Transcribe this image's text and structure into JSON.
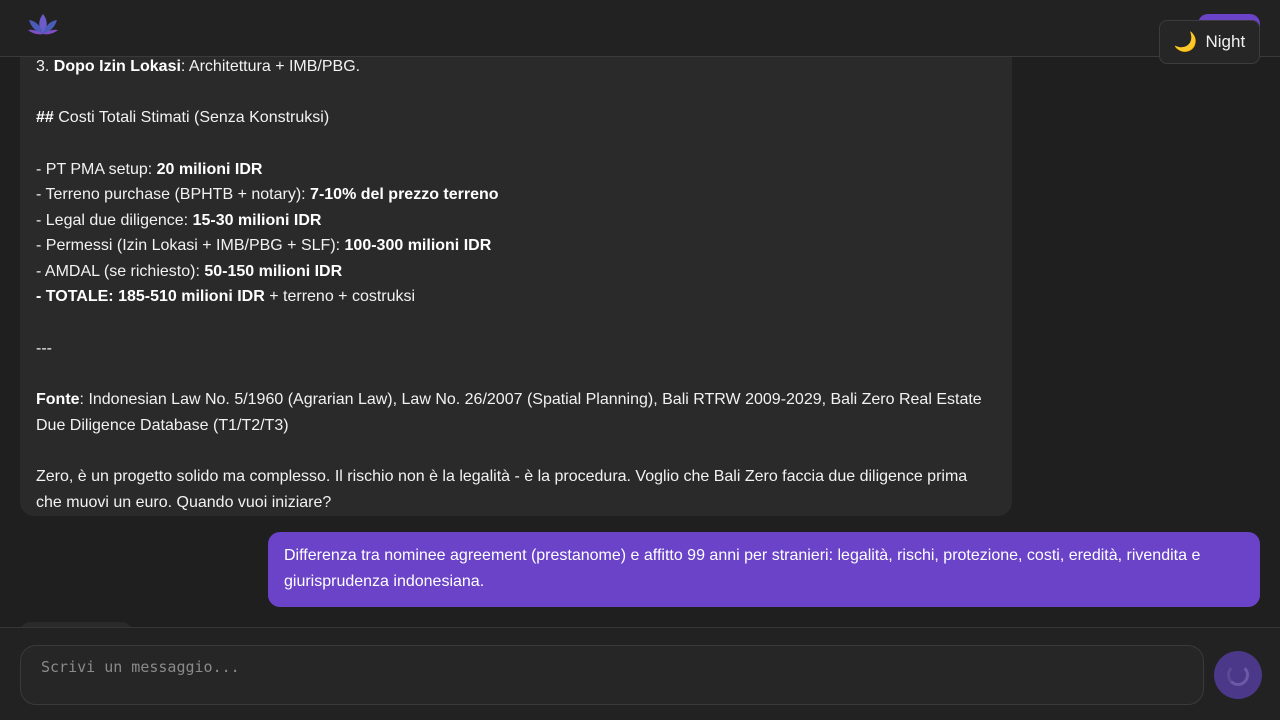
{
  "header": {
    "night_label": "Night",
    "night_icon": "moon-icon",
    "accent_color": "#6a43c9"
  },
  "chat": {
    "ai_message": {
      "line_top": {
        "prefix": "3. ",
        "bold": "Dopo Izin Lokasi",
        "rest": ": Architettura + IMB/PBG."
      },
      "heading": {
        "hashes": "##",
        "text": " Costi Totali Stimati (Senza Konstruksi)"
      },
      "costs": [
        {
          "label": "- PT PMA setup: ",
          "value": "20 milioni IDR",
          "suffix": ""
        },
        {
          "label": "- Terreno purchase (BPHTB + notary): ",
          "value": "7-10% del prezzo terreno",
          "suffix": ""
        },
        {
          "label": "- Legal due diligence: ",
          "value": "15-30 milioni IDR",
          "suffix": ""
        },
        {
          "label": "- Permessi (Izin Lokasi + IMB/PBG + SLF): ",
          "value": "100-300 milioni IDR",
          "suffix": ""
        },
        {
          "label": "- AMDAL (se richiesto): ",
          "value": "50-150 milioni IDR",
          "suffix": ""
        },
        {
          "label": "- ",
          "value": "TOTALE: 185-510 milioni IDR",
          "suffix": " + terreno + costruksi"
        }
      ],
      "separator": "---",
      "source": {
        "label": "Fonte",
        "text": ": Indonesian Law No. 5/1960 (Agrarian Law), Law No. 26/2007 (Spatial Planning), Bali RTRW 2009-2029, Bali Zero Real Estate Due Diligence Database (T1/T2/T3)"
      },
      "closing": "Zero, è un progetto solido ma complesso. Il rischio non è la legalità - è la procedura. Voglio che Bali Zero faccia due diligence prima che muovi un euro. Quando vuoi iniziare?"
    },
    "user_message": "Differenza tra nominee agreement (prestanome) e affitto 99 anni per stranieri: legalità, rischi, protezione, costi, eredità, rivendita e giurisprudenza indonesiana."
  },
  "composer": {
    "placeholder": "Scrivi un messaggio...",
    "value": "",
    "send_icon": "loading-spinner-icon"
  }
}
